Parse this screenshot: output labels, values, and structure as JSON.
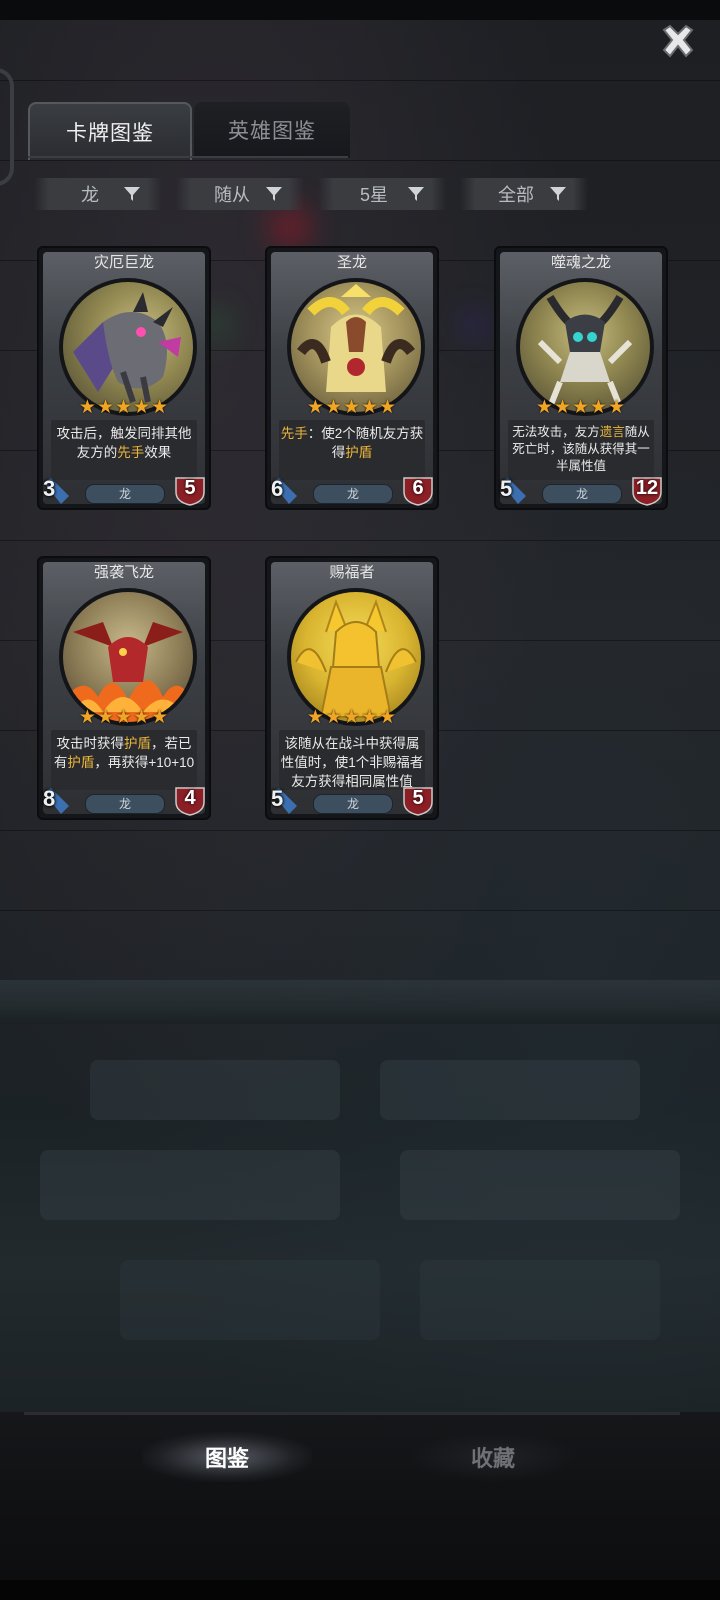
{
  "tabs": [
    {
      "label": "卡牌图鉴",
      "active": true
    },
    {
      "label": "英雄图鉴",
      "active": false
    }
  ],
  "filters": [
    {
      "label": "龙"
    },
    {
      "label": "随从"
    },
    {
      "label": "5星"
    },
    {
      "label": "全部"
    }
  ],
  "cards": [
    {
      "name": "灾厄巨龙",
      "stars": "★★★★★",
      "desc_parts": [
        "攻击后，触发同排其他友方的",
        "先手",
        "效果"
      ],
      "tribe": "龙",
      "attack": "3",
      "health": "5",
      "art": "purple-dragon"
    },
    {
      "name": "圣龙",
      "stars": "★★★★★",
      "desc_parts": [
        "先手",
        "：使2个随机友方获得",
        "护盾",
        ""
      ],
      "tribe": "龙",
      "attack": "6",
      "health": "6",
      "art": "holy-dragon"
    },
    {
      "name": "噬魂之龙",
      "stars": "★★★★★",
      "desc_parts": [
        "无法攻击，友方",
        "遗言",
        "随从死亡时，该随从获得其一半属性值"
      ],
      "tribe": "龙",
      "attack": "5",
      "health": "12",
      "art": "bone-dragon"
    },
    {
      "name": "强袭飞龙",
      "stars": "★★★★★",
      "desc_parts": [
        "攻击时获得",
        "护盾",
        "，若已有",
        "护盾",
        "，再获得+10+10"
      ],
      "tribe": "龙",
      "attack": "8",
      "health": "4",
      "art": "fire-wyvern"
    },
    {
      "name": "赐福者",
      "stars": "★★★★★",
      "desc_parts": [
        "该随从在战斗中获得属性值时，使1个非赐福者友方获得相同属性值"
      ],
      "tribe": "龙",
      "attack": "5",
      "health": "5",
      "art": "golden-dragon"
    }
  ],
  "bottom_tabs": [
    {
      "label": "图鉴",
      "active": true
    },
    {
      "label": "收藏",
      "active": false
    }
  ],
  "colors": {
    "star": "#f0a525",
    "keyword_highlight": "#e9b53a",
    "health_shield": "#8b1f25",
    "attack_sword": "#3b6fb0"
  },
  "icons": {
    "close": "close-icon",
    "filter": "filter-funnel-icon",
    "attack": "sword-icon",
    "health": "shield-icon"
  }
}
